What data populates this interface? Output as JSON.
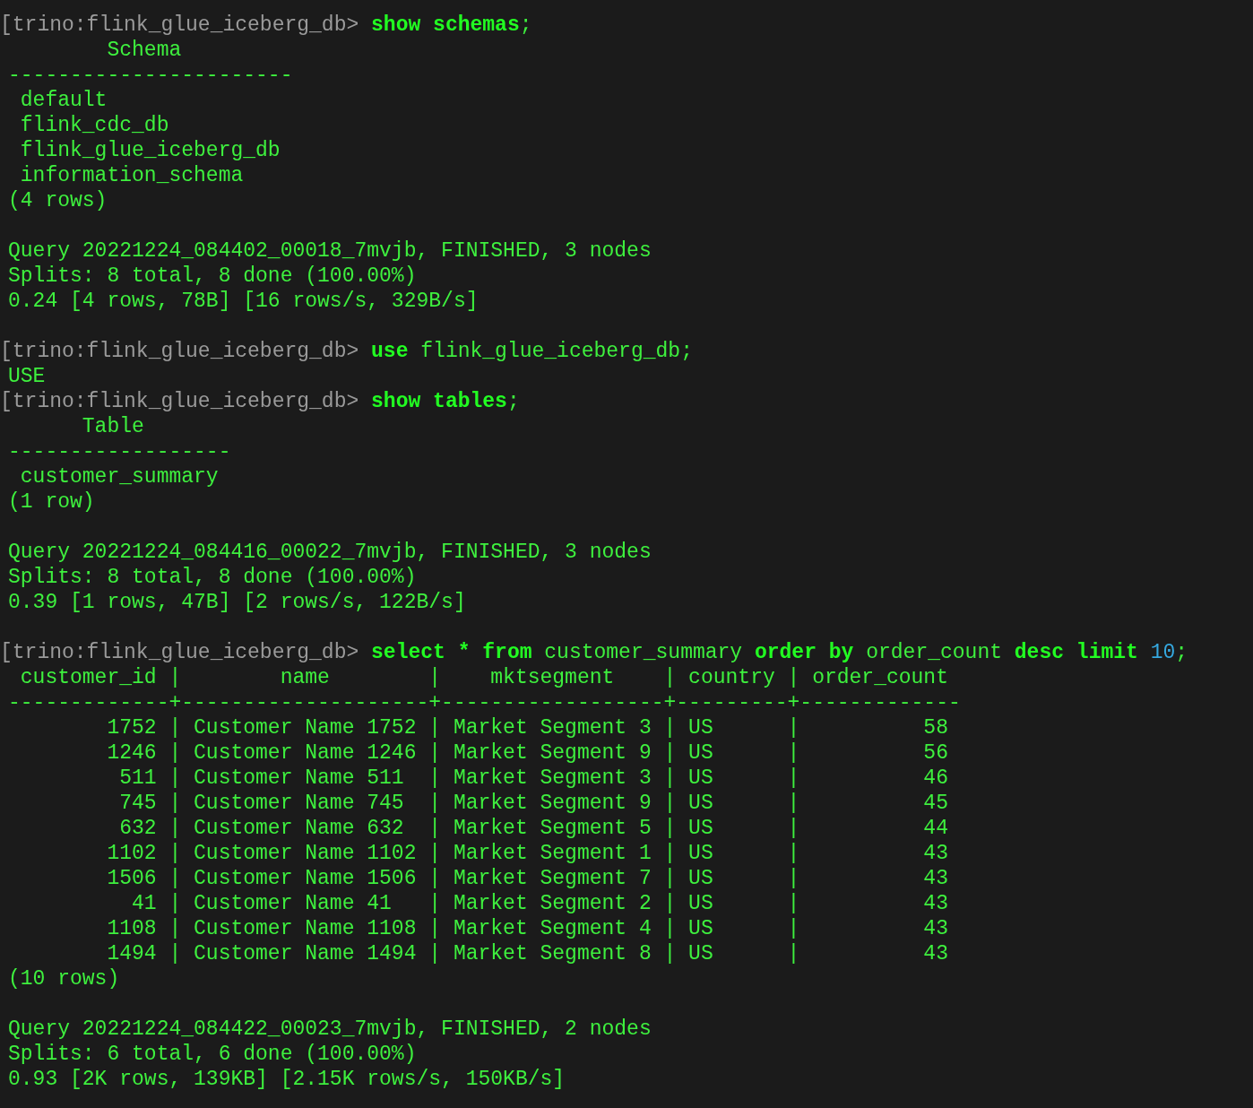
{
  "lines": [
    {
      "kind": "prompt",
      "prompt": "[trino:flink_glue_iceberg_db>",
      "command": [
        {
          "kind": "keyword",
          "text": "show schemas"
        },
        {
          "kind": "plain",
          "text": ";"
        }
      ]
    },
    {
      "kind": "output",
      "text": "        Schema"
    },
    {
      "kind": "output",
      "text": "-----------------------"
    },
    {
      "kind": "output",
      "text": " default"
    },
    {
      "kind": "output",
      "text": " flink_cdc_db"
    },
    {
      "kind": "output",
      "text": " flink_glue_iceberg_db"
    },
    {
      "kind": "output",
      "text": " information_schema"
    },
    {
      "kind": "output",
      "text": "(4 rows)"
    },
    {
      "kind": "blank"
    },
    {
      "kind": "output",
      "text": "Query 20221224_084402_00018_7mvjb, FINISHED, 3 nodes"
    },
    {
      "kind": "output",
      "text": "Splits: 8 total, 8 done (100.00%)"
    },
    {
      "kind": "output",
      "text": "0.24 [4 rows, 78B] [16 rows/s, 329B/s]"
    },
    {
      "kind": "blank"
    },
    {
      "kind": "prompt",
      "prompt": "[trino:flink_glue_iceberg_db>",
      "command": [
        {
          "kind": "keyword",
          "text": "use"
        },
        {
          "kind": "plain",
          "text": " flink_glue_iceberg_db;"
        }
      ]
    },
    {
      "kind": "output",
      "text": "USE"
    },
    {
      "kind": "prompt",
      "prompt": "[trino:flink_glue_iceberg_db>",
      "command": [
        {
          "kind": "keyword",
          "text": "show tables"
        },
        {
          "kind": "plain",
          "text": ";"
        }
      ]
    },
    {
      "kind": "output",
      "text": "      Table"
    },
    {
      "kind": "output",
      "text": "------------------"
    },
    {
      "kind": "output",
      "text": " customer_summary"
    },
    {
      "kind": "output",
      "text": "(1 row)"
    },
    {
      "kind": "blank"
    },
    {
      "kind": "output",
      "text": "Query 20221224_084416_00022_7mvjb, FINISHED, 3 nodes"
    },
    {
      "kind": "output",
      "text": "Splits: 8 total, 8 done (100.00%)"
    },
    {
      "kind": "output",
      "text": "0.39 [1 rows, 47B] [2 rows/s, 122B/s]"
    },
    {
      "kind": "blank"
    },
    {
      "kind": "prompt",
      "prompt": "[trino:flink_glue_iceberg_db>",
      "command": [
        {
          "kind": "keyword",
          "text": "select * from"
        },
        {
          "kind": "plain",
          "text": " customer_summary "
        },
        {
          "kind": "keyword",
          "text": "order by"
        },
        {
          "kind": "plain",
          "text": " order_count "
        },
        {
          "kind": "keyword",
          "text": "desc limit"
        },
        {
          "kind": "number",
          "text": " 10"
        },
        {
          "kind": "plain",
          "text": ";"
        }
      ]
    },
    {
      "kind": "output",
      "text": " customer_id |        name        |    mktsegment    | country | order_count"
    },
    {
      "kind": "output",
      "text": "-------------+--------------------+------------------+---------+-------------"
    },
    {
      "kind": "output",
      "text": "        1752 | Customer Name 1752 | Market Segment 3 | US      |          58"
    },
    {
      "kind": "output",
      "text": "        1246 | Customer Name 1246 | Market Segment 9 | US      |          56"
    },
    {
      "kind": "output",
      "text": "         511 | Customer Name 511  | Market Segment 3 | US      |          46"
    },
    {
      "kind": "output",
      "text": "         745 | Customer Name 745  | Market Segment 9 | US      |          45"
    },
    {
      "kind": "output",
      "text": "         632 | Customer Name 632  | Market Segment 5 | US      |          44"
    },
    {
      "kind": "output",
      "text": "        1102 | Customer Name 1102 | Market Segment 1 | US      |          43"
    },
    {
      "kind": "output",
      "text": "        1506 | Customer Name 1506 | Market Segment 7 | US      |          43"
    },
    {
      "kind": "output",
      "text": "          41 | Customer Name 41   | Market Segment 2 | US      |          43"
    },
    {
      "kind": "output",
      "text": "        1108 | Customer Name 1108 | Market Segment 4 | US      |          43"
    },
    {
      "kind": "output",
      "text": "        1494 | Customer Name 1494 | Market Segment 8 | US      |          43"
    },
    {
      "kind": "output",
      "text": "(10 rows)"
    },
    {
      "kind": "blank"
    },
    {
      "kind": "output",
      "text": "Query 20221224_084422_00023_7mvjb, FINISHED, 2 nodes"
    },
    {
      "kind": "output",
      "text": "Splits: 6 total, 6 done (100.00%)"
    },
    {
      "kind": "output",
      "text": "0.93 [2K rows, 139KB] [2.15K rows/s, 150KB/s]"
    }
  ]
}
